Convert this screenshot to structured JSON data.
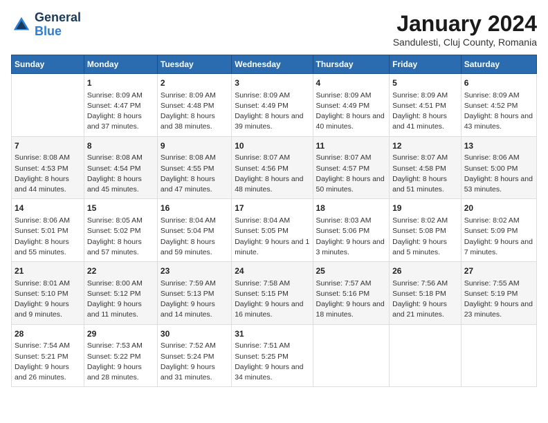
{
  "header": {
    "logo_line1": "General",
    "logo_line2": "Blue",
    "title": "January 2024",
    "subtitle": "Sandulesti, Cluj County, Romania"
  },
  "weekdays": [
    "Sunday",
    "Monday",
    "Tuesday",
    "Wednesday",
    "Thursday",
    "Friday",
    "Saturday"
  ],
  "weeks": [
    [
      {
        "day": "",
        "sunrise": "",
        "sunset": "",
        "daylight": ""
      },
      {
        "day": "1",
        "sunrise": "Sunrise: 8:09 AM",
        "sunset": "Sunset: 4:47 PM",
        "daylight": "Daylight: 8 hours and 37 minutes."
      },
      {
        "day": "2",
        "sunrise": "Sunrise: 8:09 AM",
        "sunset": "Sunset: 4:48 PM",
        "daylight": "Daylight: 8 hours and 38 minutes."
      },
      {
        "day": "3",
        "sunrise": "Sunrise: 8:09 AM",
        "sunset": "Sunset: 4:49 PM",
        "daylight": "Daylight: 8 hours and 39 minutes."
      },
      {
        "day": "4",
        "sunrise": "Sunrise: 8:09 AM",
        "sunset": "Sunset: 4:49 PM",
        "daylight": "Daylight: 8 hours and 40 minutes."
      },
      {
        "day": "5",
        "sunrise": "Sunrise: 8:09 AM",
        "sunset": "Sunset: 4:51 PM",
        "daylight": "Daylight: 8 hours and 41 minutes."
      },
      {
        "day": "6",
        "sunrise": "Sunrise: 8:09 AM",
        "sunset": "Sunset: 4:52 PM",
        "daylight": "Daylight: 8 hours and 43 minutes."
      }
    ],
    [
      {
        "day": "7",
        "sunrise": "Sunrise: 8:08 AM",
        "sunset": "Sunset: 4:53 PM",
        "daylight": "Daylight: 8 hours and 44 minutes."
      },
      {
        "day": "8",
        "sunrise": "Sunrise: 8:08 AM",
        "sunset": "Sunset: 4:54 PM",
        "daylight": "Daylight: 8 hours and 45 minutes."
      },
      {
        "day": "9",
        "sunrise": "Sunrise: 8:08 AM",
        "sunset": "Sunset: 4:55 PM",
        "daylight": "Daylight: 8 hours and 47 minutes."
      },
      {
        "day": "10",
        "sunrise": "Sunrise: 8:07 AM",
        "sunset": "Sunset: 4:56 PM",
        "daylight": "Daylight: 8 hours and 48 minutes."
      },
      {
        "day": "11",
        "sunrise": "Sunrise: 8:07 AM",
        "sunset": "Sunset: 4:57 PM",
        "daylight": "Daylight: 8 hours and 50 minutes."
      },
      {
        "day": "12",
        "sunrise": "Sunrise: 8:07 AM",
        "sunset": "Sunset: 4:58 PM",
        "daylight": "Daylight: 8 hours and 51 minutes."
      },
      {
        "day": "13",
        "sunrise": "Sunrise: 8:06 AM",
        "sunset": "Sunset: 5:00 PM",
        "daylight": "Daylight: 8 hours and 53 minutes."
      }
    ],
    [
      {
        "day": "14",
        "sunrise": "Sunrise: 8:06 AM",
        "sunset": "Sunset: 5:01 PM",
        "daylight": "Daylight: 8 hours and 55 minutes."
      },
      {
        "day": "15",
        "sunrise": "Sunrise: 8:05 AM",
        "sunset": "Sunset: 5:02 PM",
        "daylight": "Daylight: 8 hours and 57 minutes."
      },
      {
        "day": "16",
        "sunrise": "Sunrise: 8:04 AM",
        "sunset": "Sunset: 5:04 PM",
        "daylight": "Daylight: 8 hours and 59 minutes."
      },
      {
        "day": "17",
        "sunrise": "Sunrise: 8:04 AM",
        "sunset": "Sunset: 5:05 PM",
        "daylight": "Daylight: 9 hours and 1 minute."
      },
      {
        "day": "18",
        "sunrise": "Sunrise: 8:03 AM",
        "sunset": "Sunset: 5:06 PM",
        "daylight": "Daylight: 9 hours and 3 minutes."
      },
      {
        "day": "19",
        "sunrise": "Sunrise: 8:02 AM",
        "sunset": "Sunset: 5:08 PM",
        "daylight": "Daylight: 9 hours and 5 minutes."
      },
      {
        "day": "20",
        "sunrise": "Sunrise: 8:02 AM",
        "sunset": "Sunset: 5:09 PM",
        "daylight": "Daylight: 9 hours and 7 minutes."
      }
    ],
    [
      {
        "day": "21",
        "sunrise": "Sunrise: 8:01 AM",
        "sunset": "Sunset: 5:10 PM",
        "daylight": "Daylight: 9 hours and 9 minutes."
      },
      {
        "day": "22",
        "sunrise": "Sunrise: 8:00 AM",
        "sunset": "Sunset: 5:12 PM",
        "daylight": "Daylight: 9 hours and 11 minutes."
      },
      {
        "day": "23",
        "sunrise": "Sunrise: 7:59 AM",
        "sunset": "Sunset: 5:13 PM",
        "daylight": "Daylight: 9 hours and 14 minutes."
      },
      {
        "day": "24",
        "sunrise": "Sunrise: 7:58 AM",
        "sunset": "Sunset: 5:15 PM",
        "daylight": "Daylight: 9 hours and 16 minutes."
      },
      {
        "day": "25",
        "sunrise": "Sunrise: 7:57 AM",
        "sunset": "Sunset: 5:16 PM",
        "daylight": "Daylight: 9 hours and 18 minutes."
      },
      {
        "day": "26",
        "sunrise": "Sunrise: 7:56 AM",
        "sunset": "Sunset: 5:18 PM",
        "daylight": "Daylight: 9 hours and 21 minutes."
      },
      {
        "day": "27",
        "sunrise": "Sunrise: 7:55 AM",
        "sunset": "Sunset: 5:19 PM",
        "daylight": "Daylight: 9 hours and 23 minutes."
      }
    ],
    [
      {
        "day": "28",
        "sunrise": "Sunrise: 7:54 AM",
        "sunset": "Sunset: 5:21 PM",
        "daylight": "Daylight: 9 hours and 26 minutes."
      },
      {
        "day": "29",
        "sunrise": "Sunrise: 7:53 AM",
        "sunset": "Sunset: 5:22 PM",
        "daylight": "Daylight: 9 hours and 28 minutes."
      },
      {
        "day": "30",
        "sunrise": "Sunrise: 7:52 AM",
        "sunset": "Sunset: 5:24 PM",
        "daylight": "Daylight: 9 hours and 31 minutes."
      },
      {
        "day": "31",
        "sunrise": "Sunrise: 7:51 AM",
        "sunset": "Sunset: 5:25 PM",
        "daylight": "Daylight: 9 hours and 34 minutes."
      },
      {
        "day": "",
        "sunrise": "",
        "sunset": "",
        "daylight": ""
      },
      {
        "day": "",
        "sunrise": "",
        "sunset": "",
        "daylight": ""
      },
      {
        "day": "",
        "sunrise": "",
        "sunset": "",
        "daylight": ""
      }
    ]
  ]
}
